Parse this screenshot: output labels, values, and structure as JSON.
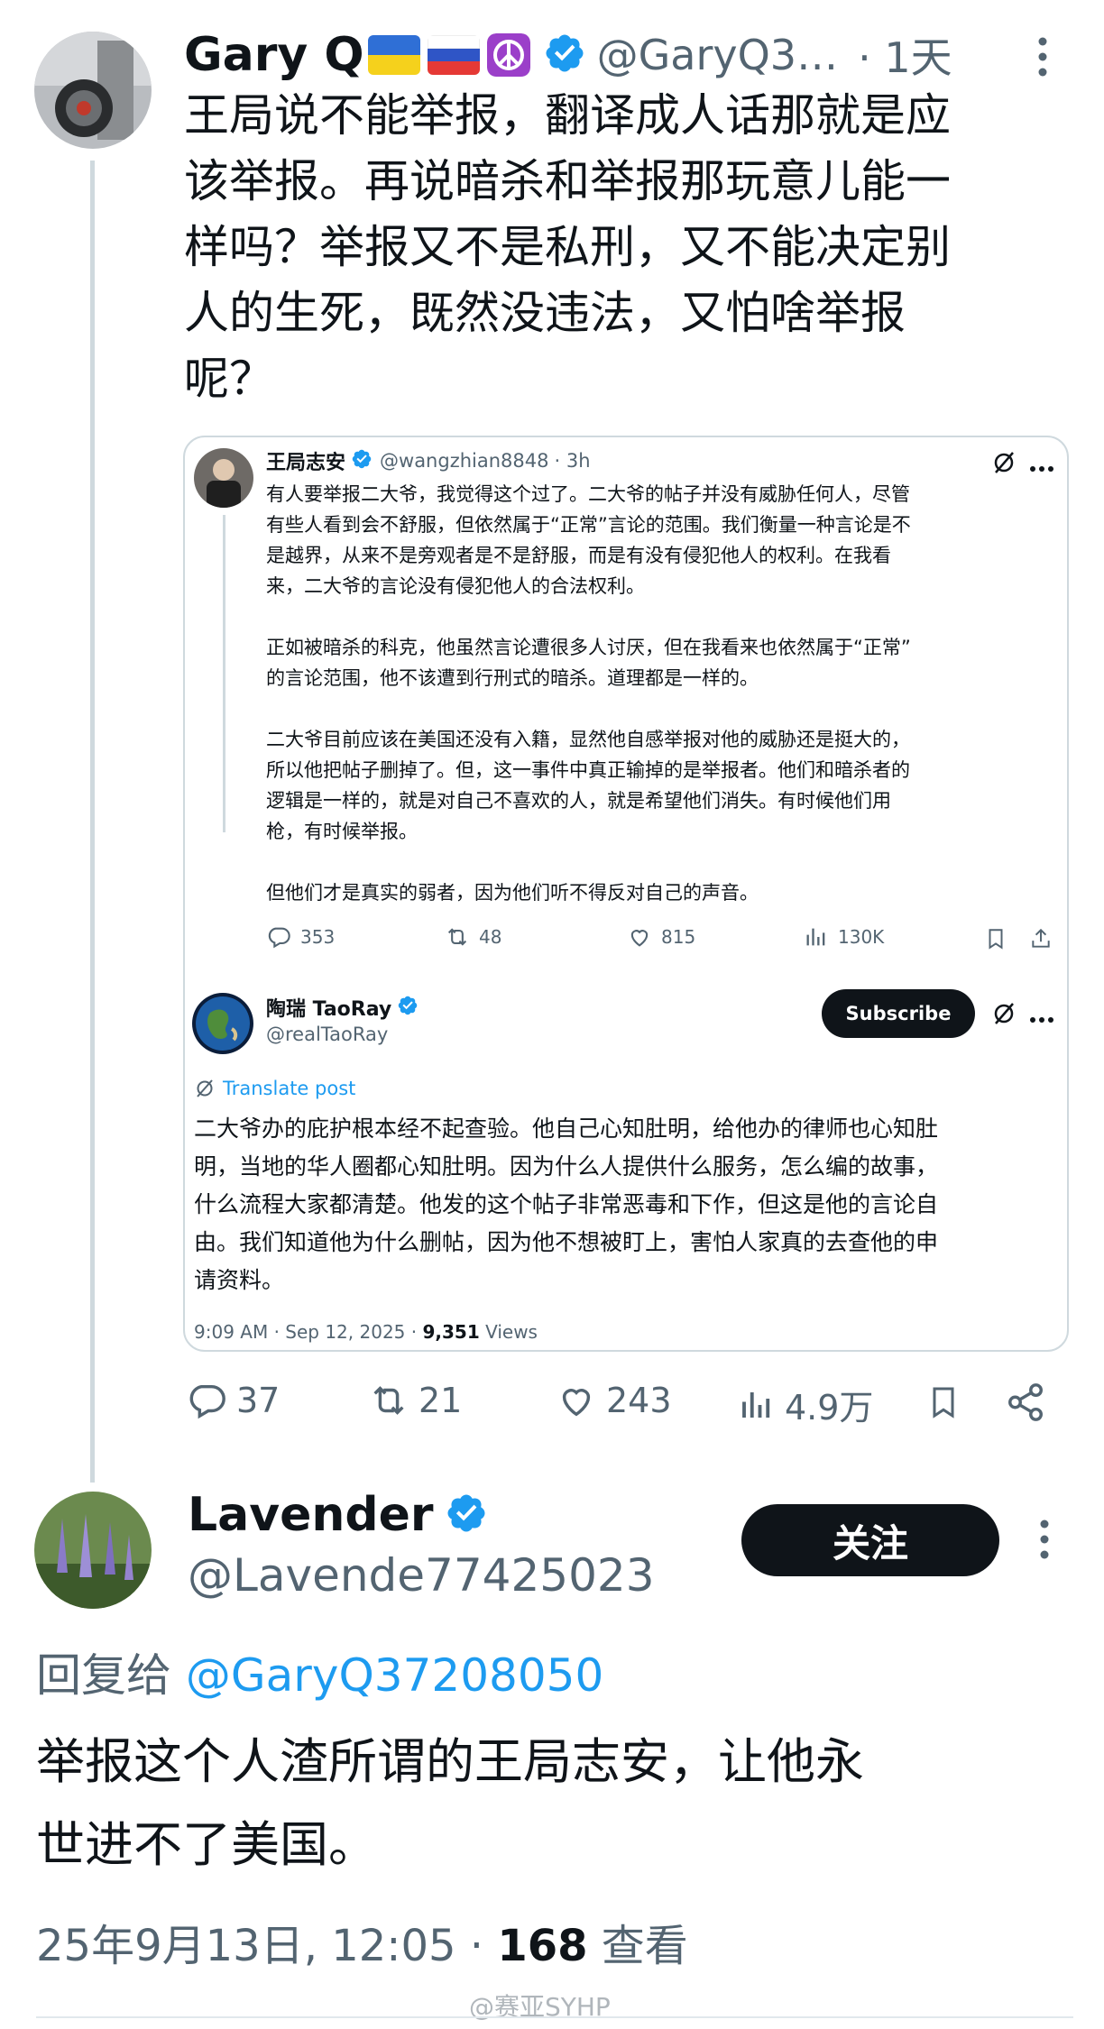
{
  "tweet1": {
    "name": "Gary Q",
    "handle": "@GaryQ3…",
    "time": "· 1天",
    "text_lines": [
      "王局说不能举报，翻译成人话那就是应",
      "该举报。再说暗杀和举报那玩意儿能一",
      "样吗？举报又不是私刑，又不能决定别",
      "人的生死，既然没违法，又怕啥举报",
      "呢？"
    ],
    "stats": {
      "reply": "37",
      "retweet": "21",
      "like": "243",
      "views": "4.9万"
    }
  },
  "quoted": {
    "author": "王局志安",
    "handle": "@wangzhian8848",
    "time": "· 3h",
    "para1": [
      "有人要举报二大爷，我觉得这个过了。二大爷的帖子并没有威胁任何人，尽管",
      "有些人看到会不舒服，但依然属于“正常”言论的范围。我们衡量一种言论是不",
      "是越界，从来不是旁观者是不是舒服，而是有没有侵犯他人的权利。在我看",
      "来，二大爷的言论没有侵犯他人的合法权利。"
    ],
    "para2": [
      "正如被暗杀的科克，他虽然言论遭很多人讨厌，但在我看来也依然属于“正常”",
      "的言论范围，他不该遭到行刑式的暗杀。道理都是一样的。"
    ],
    "para3": [
      "二大爷目前应该在美国还没有入籍，显然他自感举报对他的威胁还是挺大的，",
      "所以他把帖子删掉了。但，这一事件中真正输掉的是举报者。他们和暗杀者的",
      "逻辑是一样的，就是对自己不喜欢的人，就是希望他们消失。有时候他们用",
      "枪，有时候举报。"
    ],
    "para4": [
      "但他们才是真实的弱者，因为他们听不得反对自己的声音。"
    ],
    "stats": {
      "reply": "353",
      "retweet": "48",
      "like": "815",
      "views": "130K"
    },
    "reply_author": "陶瑞 TaoRay",
    "reply_handle": "@realTaoRay",
    "subscribe": "Subscribe",
    "translate": "Translate post",
    "reply_text": [
      "二大爷办的庇护根本经不起查验。他自己心知肚明，给他办的律师也心知肚",
      "明，当地的华人圈都心知肚明。因为什么人提供什么服务，怎么编的故事，",
      "什么流程大家都清楚。他发的这个帖子非常恶毒和下作，但这是他的言论自",
      "由。我们知道他为什么删帖，因为他不想被盯上，害怕人家真的去查他的申",
      "请资料。"
    ],
    "meta_time": "9:09 AM · Sep 12, 2025 · ",
    "meta_views": "9,351",
    "meta_views_label": " Views"
  },
  "tweet2": {
    "name": "Lavender",
    "handle": "@Lavende77425023",
    "follow": "关注",
    "reply_prefix": "回复给",
    "reply_to": "@GaryQ37208050",
    "text_lines": [
      "举报这个人渣所谓的王局志安，让他永",
      "世进不了美国。"
    ],
    "date": "25年9月13日, 12:05 · ",
    "views": "168",
    "views_label": " 查看"
  },
  "watermark": "@赛亚SYHP",
  "colors": {
    "accent": "#1d9bf0",
    "muted": "#536471",
    "text": "#0f1419"
  }
}
